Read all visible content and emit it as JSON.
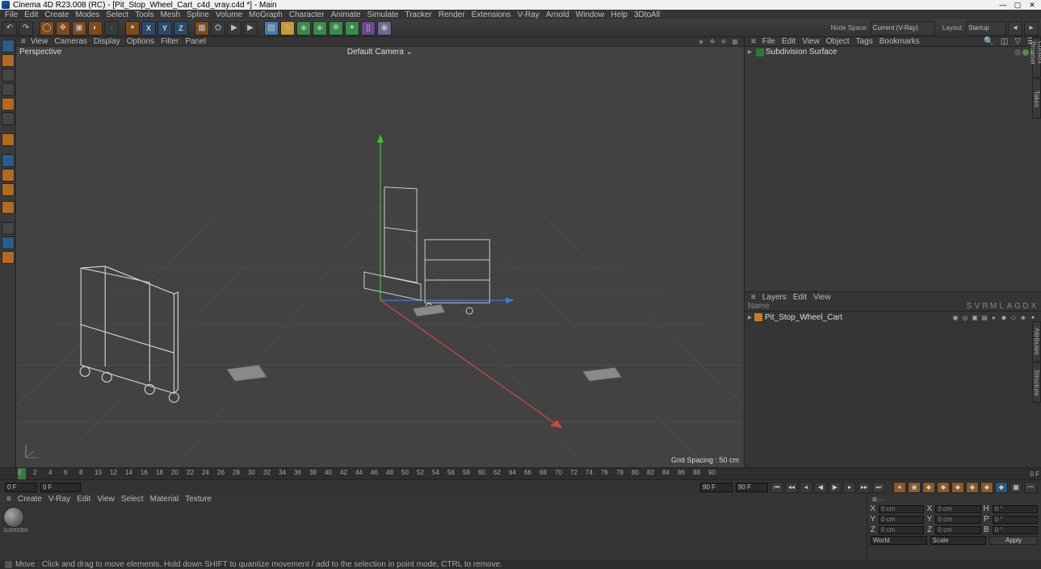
{
  "title_bar": {
    "text": "Cinema 4D R23.008 (RC) - [Pit_Stop_Wheel_Cart_c4d_vray.c4d *] - Main",
    "buttons": {
      "min": "—",
      "max": "▢",
      "close": "✕"
    }
  },
  "main_menu": [
    "File",
    "Edit",
    "Create",
    "Modes",
    "Select",
    "Tools",
    "Mesh",
    "Spline",
    "Volume",
    "MoGraph",
    "Character",
    "Animate",
    "Simulate",
    "Tracker",
    "Render",
    "Extensions",
    "V-Ray",
    "Arnold",
    "Window",
    "Help",
    "3DtoAll"
  ],
  "node_space": {
    "label": "Node Space:",
    "value": "Current (V-Ray)"
  },
  "layout": {
    "label": "Layout:",
    "value": "Startup"
  },
  "axes": [
    "X",
    "Y",
    "Z"
  ],
  "viewport_menu": [
    "View",
    "Cameras",
    "Display",
    "Options",
    "Filter",
    "Panel"
  ],
  "viewport": {
    "perspective_label": "Perspective",
    "camera_label": "Default Camera",
    "grid_spacing": "Grid Spacing : 50 cm"
  },
  "object_manager_menu": [
    "File",
    "Edit",
    "View",
    "Object",
    "Tags",
    "Bookmarks"
  ],
  "object_tree": {
    "root_name": "Subdivision Surface"
  },
  "layer_menu": [
    "Layers",
    "Edit",
    "View"
  ],
  "layer_header": {
    "name": "Name",
    "cols": [
      "S",
      "V",
      "R",
      "M",
      "L",
      "A",
      "G",
      "D",
      "X"
    ]
  },
  "layer_row": {
    "name": "Pit_Stop_Wheel_Cart"
  },
  "right_tabs": [
    "Content Browser",
    "Takes",
    "Attributes",
    "Structure"
  ],
  "timeline": {
    "frame_start": "0 F",
    "frame_cur": "0 F",
    "frame_end1": "90 F",
    "frame_end2": "90 F",
    "over": "0 F",
    "ticks": [
      0,
      2,
      4,
      6,
      8,
      10,
      12,
      14,
      16,
      18,
      20,
      22,
      24,
      26,
      28,
      30,
      32,
      34,
      36,
      38,
      40,
      42,
      44,
      46,
      48,
      50,
      52,
      54,
      56,
      58,
      60,
      62,
      64,
      66,
      68,
      70,
      72,
      74,
      76,
      78,
      80,
      82,
      84,
      86,
      88,
      90
    ]
  },
  "material_menu": [
    "Create",
    "V-Ray",
    "Edit",
    "View",
    "Select",
    "Material",
    "Texture"
  ],
  "material": {
    "thumb_label": "1c0000b0"
  },
  "coord": {
    "header_x": "X",
    "header_y": "Y",
    "header_z": "Z",
    "rows": [
      {
        "l1": "X",
        "v1": "0 cm",
        "l2": "X",
        "v2": "0 cm",
        "l3": "H",
        "v3": "0 °"
      },
      {
        "l1": "Y",
        "v1": "0 cm",
        "l2": "Y",
        "v2": "0 cm",
        "l3": "P",
        "v3": "0 °"
      },
      {
        "l1": "Z",
        "v1": "0 cm",
        "l2": "Z",
        "v2": "0 cm",
        "l3": "B",
        "v3": "0 °"
      }
    ],
    "mode1": "World",
    "mode2": "Scale",
    "apply": "Apply"
  },
  "status": "Move : Click and drag to move elements. Hold down SHIFT to quantize movement / add to the selection in point mode, CTRL to remove."
}
